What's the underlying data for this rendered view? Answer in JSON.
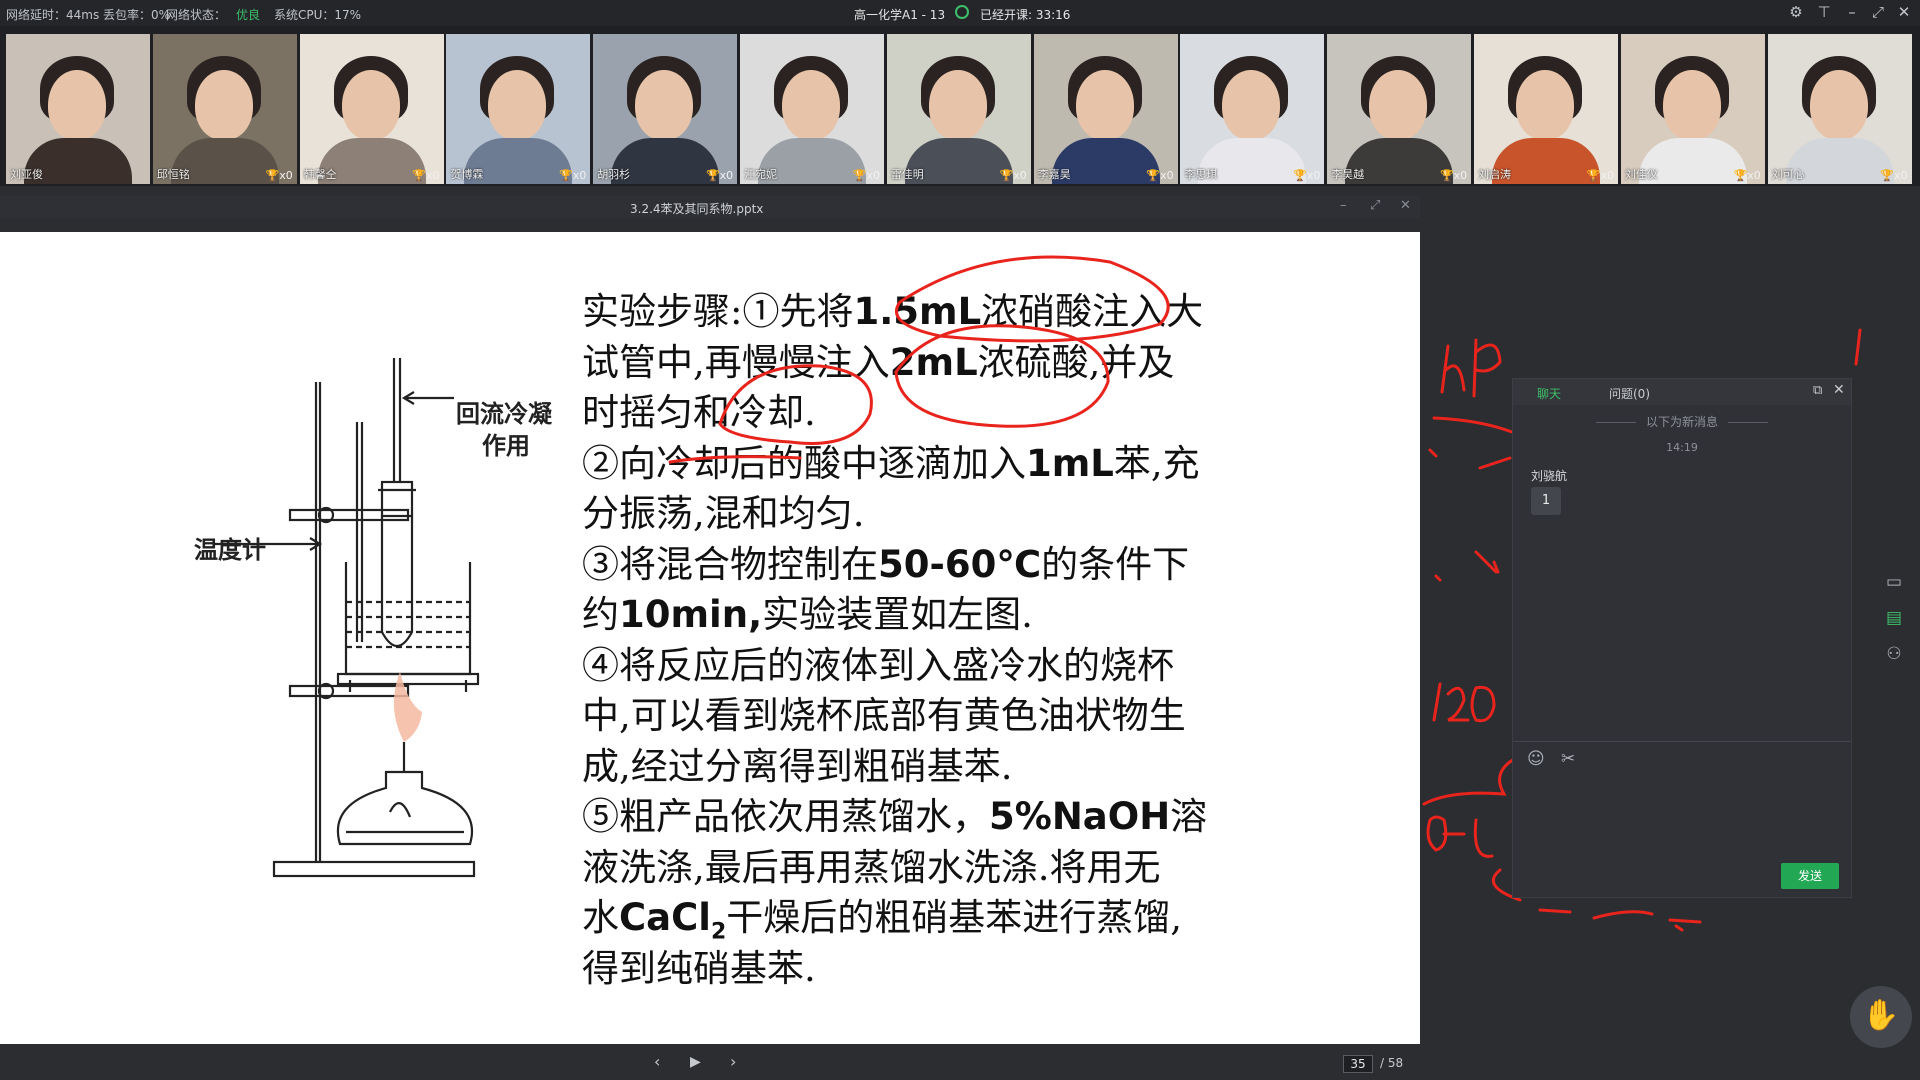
{
  "status": {
    "latency_label": "网络延时：44ms",
    "loss_label": "丢包率：0%",
    "net_label": "网络状态：",
    "net_value": "优良",
    "cpu_label": "系统CPU：17%"
  },
  "class": {
    "title": "高一化学A1 - 13",
    "elapsed": "已经开课: 33:16"
  },
  "window_controls": [
    "gear-icon",
    "pin-icon",
    "minimize-icon",
    "maximize-icon",
    "close-icon"
  ],
  "participants": [
    {
      "name": "刘亚俊",
      "cups": ""
    },
    {
      "name": "邱恒铭",
      "cups": "x0"
    },
    {
      "name": "韩馨仝",
      "cups": "x0"
    },
    {
      "name": "贺博霖",
      "cups": "x0"
    },
    {
      "name": "胡羽杉",
      "cups": "x0"
    },
    {
      "name": "江宛妮",
      "cups": "x0"
    },
    {
      "name": "雷佳明",
      "cups": "x0"
    },
    {
      "name": "李嘉昊",
      "cups": "x0"
    },
    {
      "name": "李思琪",
      "cups": "x0"
    },
    {
      "name": "李昊越",
      "cups": "x0"
    },
    {
      "name": "刘启涛",
      "cups": "x0"
    },
    {
      "name": "刘佳仪",
      "cups": "x0"
    },
    {
      "name": "刘可心",
      "cups": "x0"
    }
  ],
  "slide": {
    "filename": "3.2.4苯及其同系物.pptx",
    "page": "35",
    "total": "/ 58",
    "labels": {
      "condenser": "回流冷凝",
      "condenser2": "作用",
      "thermometer": "温度计"
    },
    "lines": [
      [
        "实验步骤:①先将",
        "1.5mL",
        "浓硝酸注入大"
      ],
      [
        "试管中,再慢慢注入",
        "2mL",
        "浓硫酸,并及"
      ],
      [
        "时摇匀和冷却."
      ],
      [
        "②向冷却后的酸中逐滴加入",
        "1mL",
        "苯,充"
      ],
      [
        "分振荡,混和均匀."
      ],
      [
        "③将混合物控制在",
        "50-60℃",
        "的条件下"
      ],
      [
        "约",
        "10min,",
        "实验装置如左图."
      ],
      [
        "④将反应后的液体到入盛冷水的烧杯"
      ],
      [
        "中,可以看到烧杯底部有黄色油状物生"
      ],
      [
        "成,经过分离得到粗硝基苯."
      ],
      [
        " ⑤粗产品依次用蒸馏水，",
        "5%NaOH",
        "溶"
      ],
      [
        "液洗涤,最后再用蒸馏水洗涤.将用无"
      ],
      [
        "水",
        "CaCl",
        "2",
        "干燥后的粗硝基苯进行蒸馏,"
      ],
      [
        "得到纯硝基苯."
      ]
    ]
  },
  "chat": {
    "tab_chat": "聊天",
    "tab_questions": "问题(0)",
    "new_messages": "以下为新消息",
    "time": "14:19",
    "sender": "刘骁航",
    "message": "1",
    "send_label": "发送"
  },
  "accent": "#22a755",
  "annotation_color": "#e8241c"
}
